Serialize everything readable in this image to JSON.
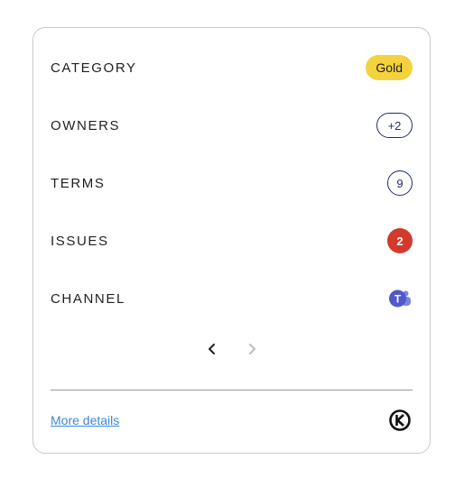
{
  "rows": {
    "category": {
      "label": "CATEGORY",
      "value": "Gold"
    },
    "owners": {
      "label": "OWNERS",
      "value": "+2"
    },
    "terms": {
      "label": "TERMS",
      "value": "9"
    },
    "issues": {
      "label": "ISSUES",
      "value": "2"
    },
    "channel": {
      "label": "CHANNEL",
      "icon": "microsoft-teams-icon"
    }
  },
  "pager": {
    "prev_icon": "chevron-left-icon",
    "next_icon": "chevron-right-icon",
    "next_disabled": true
  },
  "footer": {
    "link_label": "More details",
    "logo_icon": "k-circle-logo-icon"
  },
  "colors": {
    "gold_badge": "#f4d23d",
    "outline_badge": "#1f2d6b",
    "issues_badge": "#d23a2e",
    "teams": "#5059c9",
    "link": "#3b87d9"
  }
}
